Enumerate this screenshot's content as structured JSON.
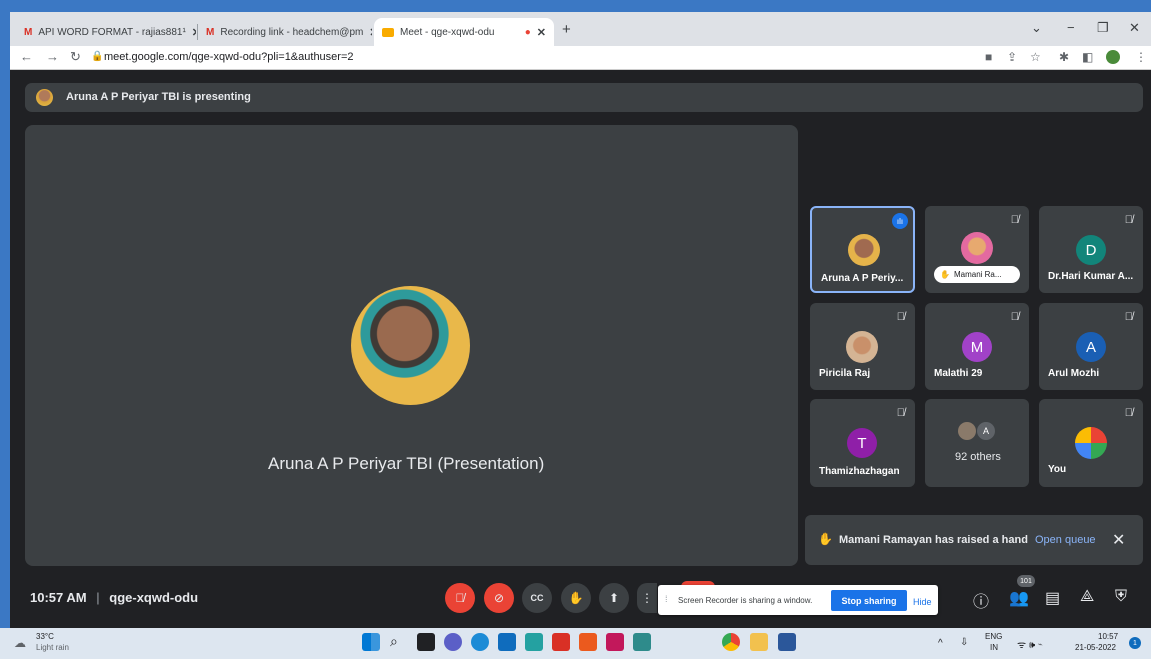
{
  "browser": {
    "tabs": [
      {
        "label": "API WORD FORMAT - rajias881¹"
      },
      {
        "label": "Recording link - headchem@pm"
      },
      {
        "label": "Meet - qge-xqwd-odu"
      }
    ],
    "url": "meet.google.com/qge-xqwd-odu?pli=1&authuser=2"
  },
  "meet": {
    "presenting_banner": "Aruna A P Periyar TBI is presenting",
    "main_tile_name": "Aruna A P Periyar TBI (Presentation)",
    "participants": [
      {
        "name": "Aruna A P Periy..."
      },
      {
        "name": "Mamani Ra..."
      },
      {
        "name": "Dr.Hari Kumar A...",
        "initial": "D",
        "color": "#12857a"
      },
      {
        "name": "Piricila Raj"
      },
      {
        "name": "Malathi 29",
        "initial": "M",
        "color": "#a142c8"
      },
      {
        "name": "Arul Mozhi",
        "initial": "A",
        "color": "#1a5fb4"
      },
      {
        "name": "Thamizhazhagan",
        "initial": "T",
        "color": "#8f1fa8"
      },
      {
        "name": "92 others",
        "initial": "A"
      },
      {
        "name": "You"
      }
    ],
    "toast": {
      "text": "Mamani Ramayan has raised a hand",
      "link": "Open queue"
    },
    "time": "10:57 AM",
    "meeting_code": "qge-xqwd-odu",
    "people_count": "101",
    "share_bar": {
      "text": "Screen Recorder is sharing a window.",
      "stop": "Stop sharing",
      "hide": "Hide"
    }
  },
  "taskbar": {
    "weather_temp": "33°C",
    "weather_desc": "Light rain",
    "lang": "ENG",
    "region": "IN",
    "clock_time": "10:57",
    "clock_date": "21-05-2022",
    "notif_count": "1"
  }
}
